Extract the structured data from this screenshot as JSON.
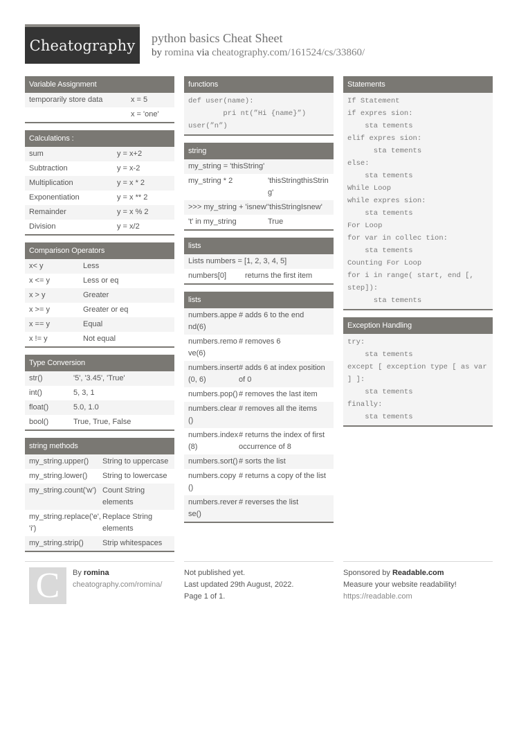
{
  "header": {
    "logo": "Cheatography",
    "title": "python basics Cheat Sheet",
    "by_prefix": "by",
    "author": "romina",
    "via": "via",
    "url": "cheatography.com/161524/cs/33860/"
  },
  "sections": {
    "variable_assignment": {
      "title": "Variable Assignment",
      "rows": [
        [
          "temporarily store data",
          "x = 5"
        ],
        [
          "",
          "x = 'one'"
        ]
      ]
    },
    "calculations": {
      "title": "Calculations :",
      "rows": [
        [
          "sum",
          "y = x+2"
        ],
        [
          "Subtraction",
          "y = x-2"
        ],
        [
          "Multiplication",
          "y = x * 2"
        ],
        [
          "Exponentiation",
          "y = x ** 2"
        ],
        [
          "Remainder",
          "y = x % 2"
        ],
        [
          "Division",
          "y = x/2"
        ]
      ]
    },
    "comparison": {
      "title": "Comparison Operators",
      "rows": [
        [
          "x< y",
          "Less"
        ],
        [
          "x <= y",
          "Less or eq"
        ],
        [
          "x > y",
          "Greater"
        ],
        [
          "x >= y",
          "Greater or eq"
        ],
        [
          "x == y",
          "Equal"
        ],
        [
          "x != y",
          "Not equal"
        ]
      ]
    },
    "type_conversion": {
      "title": "Type Conversion",
      "rows": [
        [
          "str()",
          "'5', '3.45', 'True'"
        ],
        [
          "int()",
          "5, 3, 1"
        ],
        [
          "float()",
          "5.0, 1.0"
        ],
        [
          "bool()",
          "True, True, False"
        ]
      ]
    },
    "string_methods": {
      "title": "string methods",
      "rows": [
        [
          "my_string.upper()",
          "String to uppercase"
        ],
        [
          "my_string.lower()",
          "String to lowercase"
        ],
        [
          "my_string.count('w')",
          "Count String elements"
        ],
        [
          "my_string.replace('e', 'i')",
          "Replace String elements"
        ],
        [
          "my_string.strip()",
          "Strip whitespaces"
        ]
      ]
    },
    "functions": {
      "title": "functions",
      "lines": [
        "def user(name):",
        "        pri nt(”Hi {name}”)",
        "user(”n”)"
      ]
    },
    "string": {
      "title": "string",
      "full_row": "my_string = 'thisString'",
      "rows": [
        [
          "my_string * 2",
          "'thisStringthisString'"
        ],
        [
          ">>> my_string + 'isnew'",
          "'thisStringIsnew'"
        ],
        [
          "'t' in my_string",
          "True"
        ]
      ]
    },
    "lists1": {
      "title": "lists",
      "full_row": "Lists numbers = [1, 2, 3, 4, 5]",
      "rows": [
        [
          "numbers[0]",
          "returns the first item"
        ]
      ]
    },
    "lists2": {
      "title": "lists",
      "rows": [
        [
          "numbers.append(6)",
          "# adds 6 to the end"
        ],
        [
          "numbers.remove(6)",
          "# removes 6"
        ],
        [
          "numbers.insert(0, 6)",
          "# adds 6 at index position of 0"
        ],
        [
          "numbers.pop()",
          "# removes the last item"
        ],
        [
          "numbers.clear()",
          "# removes all the items"
        ],
        [
          "numbers.index(8)",
          "# returns the index of first occurrence of 8"
        ],
        [
          "numbers.sort()",
          "# sorts the list"
        ],
        [
          "numbers.copy()",
          "# returns a copy of the list"
        ],
        [
          "numbers.reverse()",
          "# reverses the list"
        ]
      ]
    },
    "statements": {
      "title": "Statements",
      "lines": [
        "If Statement",
        "if expres sion:",
        "    sta tements",
        "elif expres sion:",
        "      sta tements",
        "else:",
        "    sta tements",
        "While Loop",
        "while expres sion:",
        "    sta tements",
        "For Loop",
        "for var in collec tion:",
        "    sta tements",
        "Counting For Loop",
        "for i in range( start, end [,",
        "step]):",
        "      sta tements"
      ]
    },
    "exception_handling": {
      "title": "Exception Handling",
      "lines": [
        "try:",
        "    sta tements",
        "except [ exception type [ as var",
        "] ]:",
        "    sta tements",
        "finally:",
        "    sta tements"
      ]
    }
  },
  "footer": {
    "avatar_letter": "C",
    "by_prefix": "By",
    "author": "romina",
    "author_url": "cheatography.com/romina/",
    "published": "Not published yet.",
    "updated": "Last updated 29th August, 2022.",
    "page": "Page 1 of 1.",
    "sponsor_prefix": "Sponsored by",
    "sponsor": "Readable.com",
    "sponsor_tagline": "Measure your website readability!",
    "sponsor_url": "https://readable.com"
  }
}
